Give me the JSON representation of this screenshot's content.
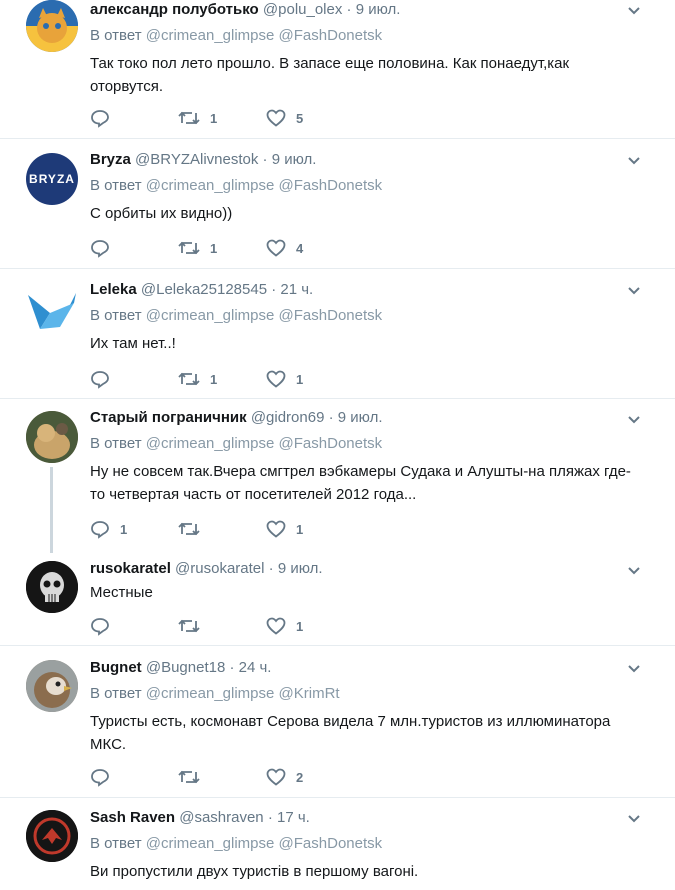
{
  "reply_prefix": "В ответ",
  "tweets": [
    {
      "fullname": "александр полуботько",
      "username": "@polu_olex",
      "time": "9 июл.",
      "reply_to": [
        "@crimean_glimpse",
        "@FashDonetsk"
      ],
      "text": "Так токо пол лето прошло. В запасе еще половина. Как понаедут,как оторвутся.",
      "replies": "",
      "retweets": "1",
      "likes": "5",
      "avatar_colors": [
        "#f6c23e",
        "#2b6cb0"
      ]
    },
    {
      "fullname": "Bryza",
      "username": "@BRYZAlivnestok",
      "time": "9 июл.",
      "reply_to": [
        "@crimean_glimpse",
        "@FashDonetsk"
      ],
      "text": "С орбиты их видно))",
      "replies": "",
      "retweets": "1",
      "likes": "4",
      "avatar_text": "BRYZA",
      "avatar_colors": [
        "#1e3a78"
      ]
    },
    {
      "fullname": "Leleka",
      "username": "@Leleka25128545",
      "time": "21 ч.",
      "reply_to": [
        "@crimean_glimpse",
        "@FashDonetsk"
      ],
      "text": "Их там нет..!",
      "replies": "",
      "retweets": "1",
      "likes": "1",
      "avatar_colors": [
        "#3aa0d8"
      ]
    },
    {
      "fullname": "Старый пограничник",
      "username": "@gidron69",
      "time": "9 июл.",
      "reply_to": [
        "@crimean_glimpse",
        "@FashDonetsk"
      ],
      "text": "Ну не совсем так.Вчера смгтрел вэбкамеры Судака и Алушты-на пляжах где-то четвертая часть от посетителей 2012 года...",
      "replies": "1",
      "retweets": "",
      "likes": "1",
      "avatar_colors": [
        "#7a6a4f"
      ]
    },
    {
      "fullname": "rusokaratel",
      "username": "@rusokaratel",
      "time": "9 июл.",
      "reply_to": [],
      "text": "Местные",
      "replies": "",
      "retweets": "",
      "likes": "1",
      "avatar_colors": [
        "#111111"
      ]
    },
    {
      "fullname": "Bugnet",
      "username": "@Bugnet18",
      "time": "24 ч.",
      "reply_to": [
        "@crimean_glimpse",
        "@KrimRt"
      ],
      "text": "Туристы есть, космонавт Серова видела 7 млн.туристов из иллюминатора МКС.",
      "replies": "",
      "retweets": "",
      "likes": "2",
      "avatar_colors": [
        "#8a7a6a"
      ]
    },
    {
      "fullname": "Sash Raven",
      "username": "@sashraven",
      "time": "17 ч.",
      "reply_to": [
        "@crimean_glimpse",
        "@FashDonetsk"
      ],
      "text": "Ви пропустили двух туристів в першому вагоні.",
      "replies": "",
      "retweets": "",
      "likes": "",
      "avatar_colors": [
        "#111111",
        "#c0392b"
      ]
    }
  ]
}
